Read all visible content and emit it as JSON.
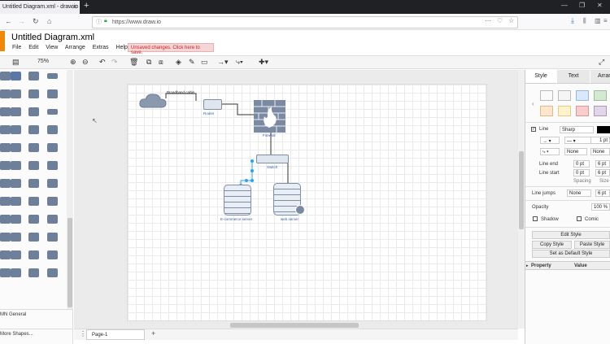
{
  "browser": {
    "tab_title": "Untitled Diagram.xml - draw.io",
    "url": "https://www.draw.io"
  },
  "app": {
    "title": "Untitled Diagram.xml",
    "menu": [
      "File",
      "Edit",
      "View",
      "Arrange",
      "Extras",
      "Help"
    ],
    "unsaved": "Unsaved changes. Click here to save.",
    "zoom": "75%"
  },
  "sidebar": {
    "footer1": "MN General",
    "footer2": "More Shapes..."
  },
  "diagram": {
    "broadband_label": "Broadband cable",
    "router_label": "Router",
    "firewall_label": "Firewall",
    "switch_label": "Switch",
    "ecommerce_label": "E-commerce server",
    "web_label": "web server"
  },
  "pages": {
    "page1": "Page-1"
  },
  "format_panel": {
    "tabs": [
      "Style",
      "Text",
      "Arrange"
    ],
    "swatches": [
      "#ffffff",
      "#f5f5f5",
      "#dae8fc",
      "#d5e8d4",
      "#e1d5e7",
      "#fff2cc",
      "#ffe6cc",
      "#ffe6cc",
      "#f8cecc",
      "#e1d5e7"
    ],
    "line_label": "Line",
    "line_style": "Sharp",
    "line_width": "1 pt",
    "none1": "None",
    "none2": "None",
    "line_end": "Line end",
    "line_start": "Line start",
    "end_val": "0 pt",
    "start_val": "0 pt",
    "end_val2": "6 pt",
    "start_val2": "6 pt",
    "spacing": "Spacing",
    "size": "Size",
    "line_jumps": "Line jumps",
    "jumps_val": "None",
    "jumps_size": "6 pt",
    "opacity": "Opacity",
    "opacity_val": "100 %",
    "shadow": "Shadow",
    "comic": "Comic",
    "edit_style": "Edit Style",
    "copy_style": "Copy Style",
    "paste_style": "Paste Style",
    "set_default": "Set as Default Style",
    "property": "Property",
    "value": "Value"
  }
}
